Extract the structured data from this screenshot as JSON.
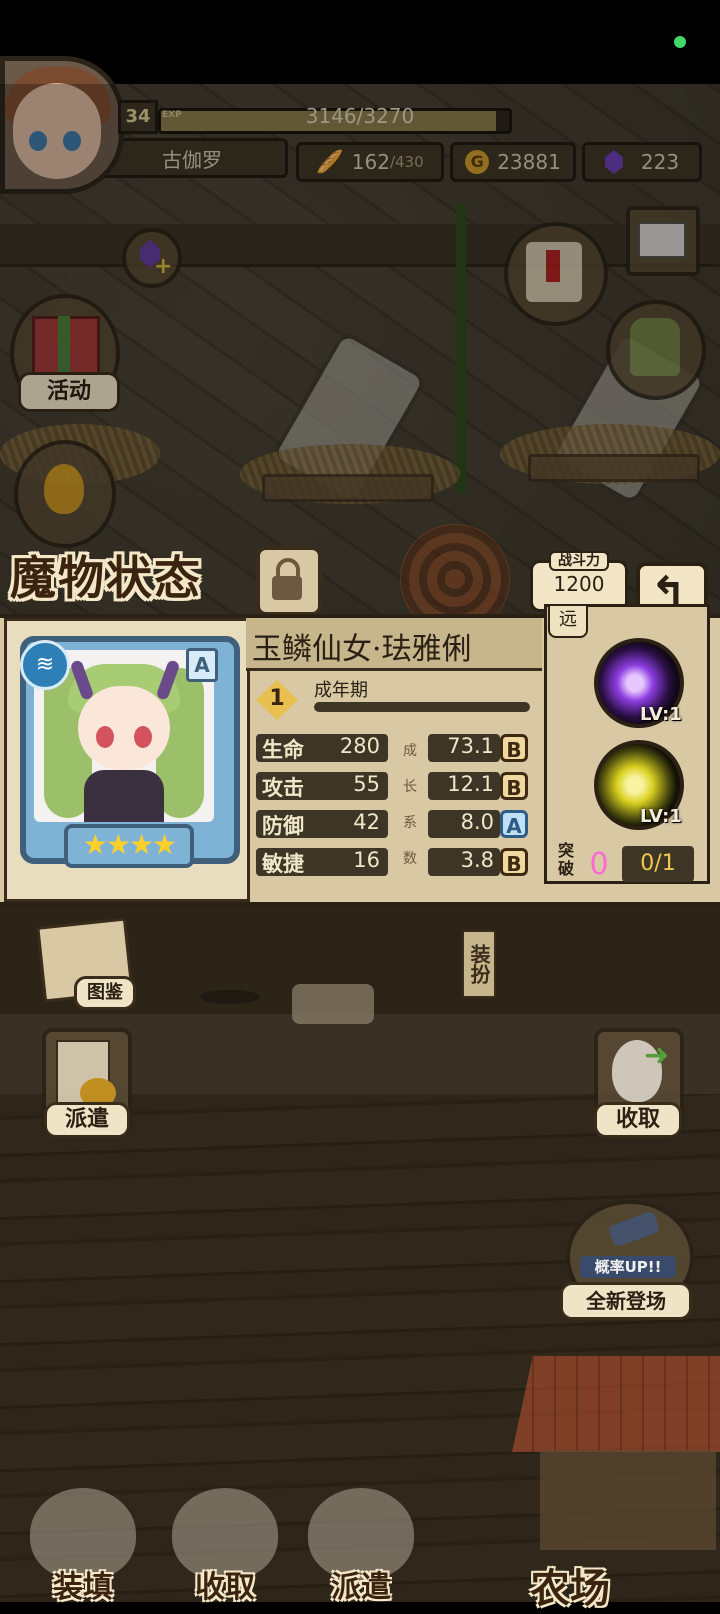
{
  "player": {
    "name": "古伽罗",
    "level": "34",
    "exp_label": "EXP",
    "exp_text": "3146/3270",
    "exp_progress": 0.962,
    "stamina_current": "162",
    "stamina_max": "/430",
    "gold": "23881",
    "gems": "223"
  },
  "side_menu": {
    "activity": "活动",
    "encyclopedia": "图鉴",
    "dispatch": "派遣",
    "collect": "收取",
    "equip_tab": "装扮",
    "promo_badge": "概率UP!!",
    "promo_label": "全新登场"
  },
  "monster_status": {
    "title": "魔物状态",
    "power_label": "战斗力",
    "power_value": "1200",
    "name": "玉鳞仙女·珐雅俐",
    "rank": "A",
    "stars": "★★★★",
    "element_icon": "water-icon",
    "stage_level": "1",
    "stage_name": "成年期",
    "growth_label_chars": [
      "成",
      "长",
      "系",
      "数"
    ],
    "stats": [
      {
        "name": "生命",
        "value": "280",
        "growth": "73.1",
        "grade": "B"
      },
      {
        "name": "攻击",
        "value": "55",
        "growth": "12.1",
        "grade": "B"
      },
      {
        "name": "防御",
        "value": "42",
        "growth": "8.0",
        "grade": "A"
      },
      {
        "name": "敏捷",
        "value": "16",
        "growth": "3.8",
        "grade": "B"
      }
    ],
    "range_tag": "远",
    "skills": [
      {
        "level": "LV:1",
        "icon": "sleep-orb-icon"
      },
      {
        "level": "LV:1",
        "icon": "feather-burst-icon"
      }
    ],
    "break_label": "突破",
    "break_value": "0",
    "break_progress": "0/1"
  },
  "bottom_nav": {
    "load": "装填",
    "collect": "收取",
    "dispatch": "派遣",
    "farm": "农场"
  },
  "colors": {
    "grade_B": "#f0d8a0",
    "grade_A": "#bfe0f5",
    "break_value": "#ff69d6",
    "accent_gold": "#f0c84a"
  }
}
